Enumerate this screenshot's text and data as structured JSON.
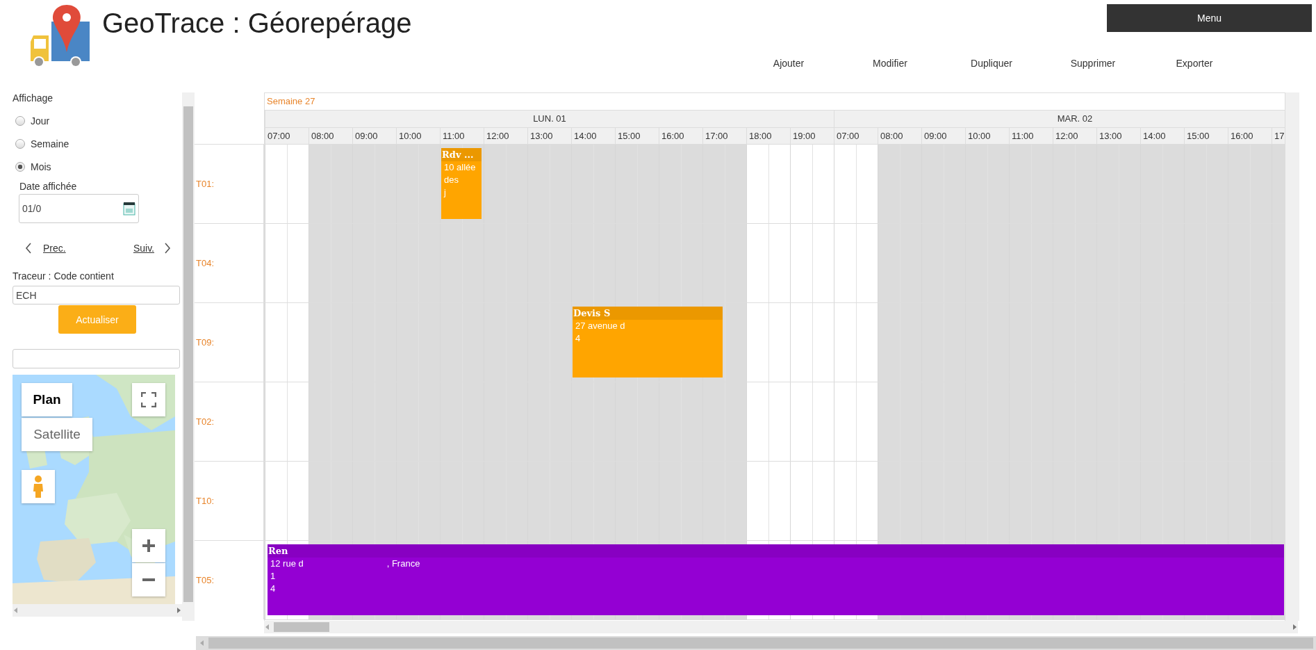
{
  "app": {
    "title": "GeoTrace : Géorepérage"
  },
  "menu_button": "Menu",
  "actions": [
    "Ajouter",
    "Modifier",
    "Dupliquer",
    "Supprimer",
    "Exporter"
  ],
  "sidebar": {
    "display_label": "Affichage",
    "display_options": [
      {
        "label": "Jour",
        "selected": false
      },
      {
        "label": "Semaine",
        "selected": false
      },
      {
        "label": "Mois",
        "selected": true
      }
    ],
    "date_label": "Date affichée",
    "date_value": "01/0",
    "prev": "Prec.",
    "next": "Suiv.",
    "filter_label": "Traceur : Code contient",
    "filter_value": "ECH",
    "refresh_button": "Actualiser",
    "map": {
      "map_types": [
        {
          "label": "Plan",
          "selected": true
        },
        {
          "label": "Satellite",
          "selected": false
        }
      ]
    }
  },
  "calendar": {
    "week_label": "Semaine 27",
    "days": [
      {
        "label": "LUN. 01",
        "hours": [
          {
            "label": "07:00",
            "off": true
          },
          {
            "label": "08:00",
            "off": false
          },
          {
            "label": "09:00",
            "off": false
          },
          {
            "label": "10:00",
            "off": false
          },
          {
            "label": "11:00",
            "off": false
          },
          {
            "label": "12:00",
            "off": false
          },
          {
            "label": "13:00",
            "off": false
          },
          {
            "label": "14:00",
            "off": false
          },
          {
            "label": "15:00",
            "off": false
          },
          {
            "label": "16:00",
            "off": false
          },
          {
            "label": "17:00",
            "off": false
          },
          {
            "label": "18:00",
            "off": true
          },
          {
            "label": "19:00",
            "off": true
          }
        ]
      },
      {
        "label": "MAR. 02",
        "hours": [
          {
            "label": "07:00",
            "off": true
          },
          {
            "label": "08:00",
            "off": false
          },
          {
            "label": "09:00",
            "off": false
          },
          {
            "label": "10:00",
            "off": false
          },
          {
            "label": "11:00",
            "off": false
          },
          {
            "label": "12:00",
            "off": false
          },
          {
            "label": "13:00",
            "off": false
          },
          {
            "label": "14:00",
            "off": false
          },
          {
            "label": "15:00",
            "off": false
          },
          {
            "label": "16:00",
            "off": false
          },
          {
            "label": "17",
            "off": false
          }
        ]
      }
    ],
    "resources": [
      {
        "label": "T01:",
        "events": [
          {
            "title": "Rdv ...",
            "color": "#ffa500",
            "lines": [
              {
                "text": "10 allée"
              },
              {
                "text": "des"
              },
              {
                "text": "j"
              }
            ]
          }
        ]
      },
      {
        "label": "T04:"
      },
      {
        "label": "T09:",
        "events": [
          {
            "title": "Devis S",
            "color": "#ffa500",
            "lines": [
              {
                "text": "27 avenue d"
              },
              {
                "text": "4"
              }
            ]
          }
        ]
      },
      {
        "label": "T02:"
      },
      {
        "label": "T10:"
      },
      {
        "label": "T05:",
        "events": [
          {
            "title": "Ren",
            "color": "#9400d3",
            "lines": [
              {
                "text": "12 rue d",
                "after": ", France"
              },
              {
                "text": "1"
              },
              {
                "text": "4"
              }
            ]
          }
        ]
      }
    ]
  }
}
